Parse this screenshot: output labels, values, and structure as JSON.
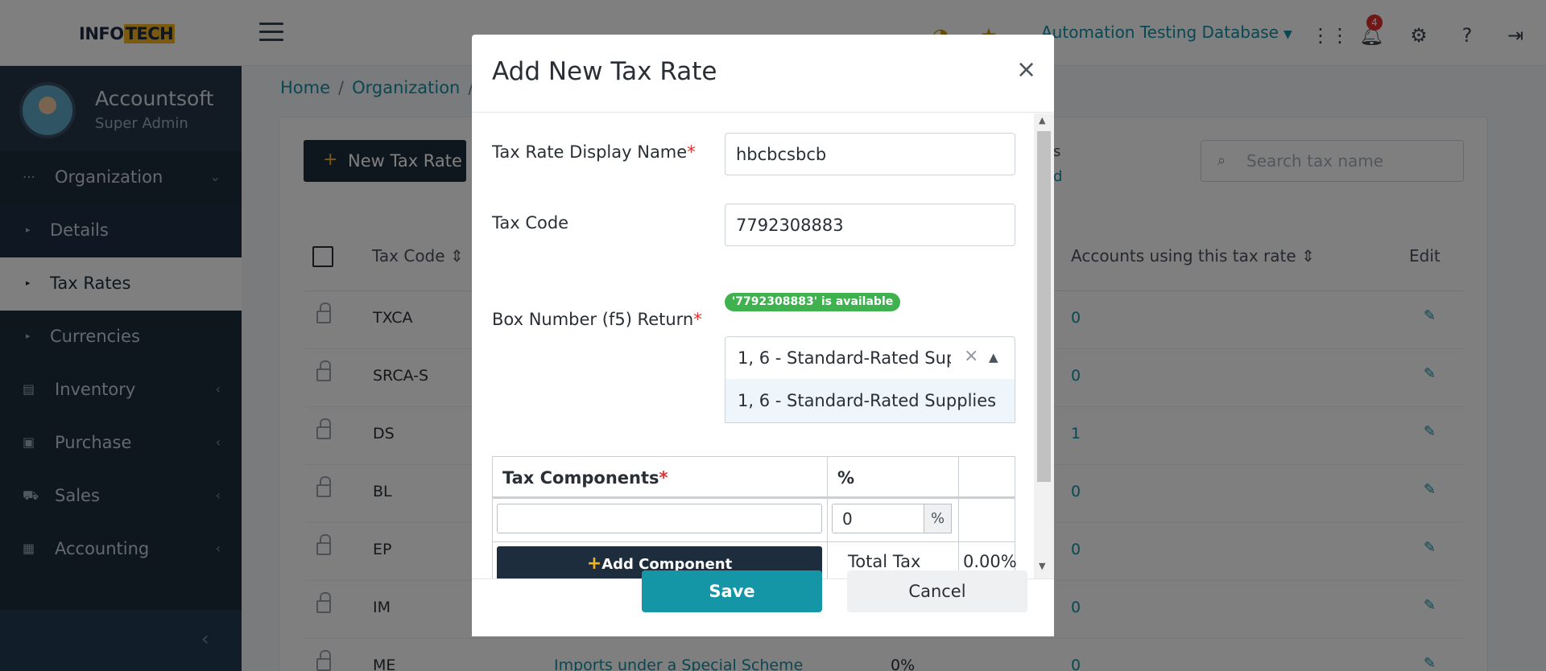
{
  "header": {
    "logo_prefix": "INFO",
    "logo_suffix": "TECH",
    "database_label": "Automation Testing Database",
    "notification_count": "4"
  },
  "sidebar": {
    "user_name": "Accountsoft",
    "user_role": "Super Admin",
    "items": [
      {
        "label": "Organization",
        "icon": "dots-icon"
      },
      {
        "label": "Details",
        "icon": "caret-right-icon"
      },
      {
        "label": "Tax Rates",
        "icon": "caret-right-icon"
      },
      {
        "label": "Currencies",
        "icon": "caret-right-icon"
      },
      {
        "label": "Inventory",
        "icon": "inventory-icon"
      },
      {
        "label": "Purchase",
        "icon": "bag-icon"
      },
      {
        "label": "Sales",
        "icon": "cart-icon"
      },
      {
        "label": "Accounting",
        "icon": "ledger-icon"
      }
    ]
  },
  "breadcrumb": {
    "home": "Home",
    "organization": "Organization"
  },
  "page": {
    "new_button": "New Tax Rate",
    "search_placeholder": "Search tax name",
    "partial_1": "s",
    "partial_2": "d"
  },
  "table": {
    "headers": {
      "code": "Tax Code",
      "accounts": "Accounts using this tax rate",
      "edit": "Edit"
    },
    "rows": [
      {
        "code": "TXCA",
        "name": "",
        "rate": "",
        "accounts": "0"
      },
      {
        "code": "SRCA-S",
        "name": "",
        "rate": "",
        "accounts": "0"
      },
      {
        "code": "DS",
        "name": "",
        "rate": "",
        "accounts": "1"
      },
      {
        "code": "BL",
        "name": "",
        "rate": "",
        "accounts": "0"
      },
      {
        "code": "EP",
        "name": "",
        "rate": "",
        "accounts": "0"
      },
      {
        "code": "IM",
        "name": "",
        "rate": "",
        "accounts": "0"
      },
      {
        "code": "ME",
        "name": "Imports under a Special Scheme",
        "rate": "0%",
        "accounts": "0"
      }
    ]
  },
  "modal": {
    "title": "Add New Tax Rate",
    "close": "×",
    "display_name_label": "Tax Rate Display Name",
    "display_name_value": "hbcbcsbcb",
    "tax_code_label": "Tax Code",
    "tax_code_value": "7792308883",
    "availability": "'7792308883' is available",
    "box_number_label": "Box Number (f5) Return",
    "box_number_value": "1, 6 - Standard-Rated Supplies",
    "box_number_option": "1, 6 - Standard-Rated Supplies",
    "required_mark": "*",
    "components_header": "Tax Components",
    "percent_header": "%",
    "percent_value": "0",
    "percent_suffix": "%",
    "add_component": "Add Component",
    "total_label": "Total Tax Rate",
    "total_value": "0.00%",
    "save": "Save",
    "cancel": "Cancel"
  },
  "colors": {
    "accent": "#1496a6",
    "sidebar": "#1d2d3d",
    "success": "#3fb24f",
    "required": "#e03131",
    "brand_yellow": "#f2b51c"
  }
}
